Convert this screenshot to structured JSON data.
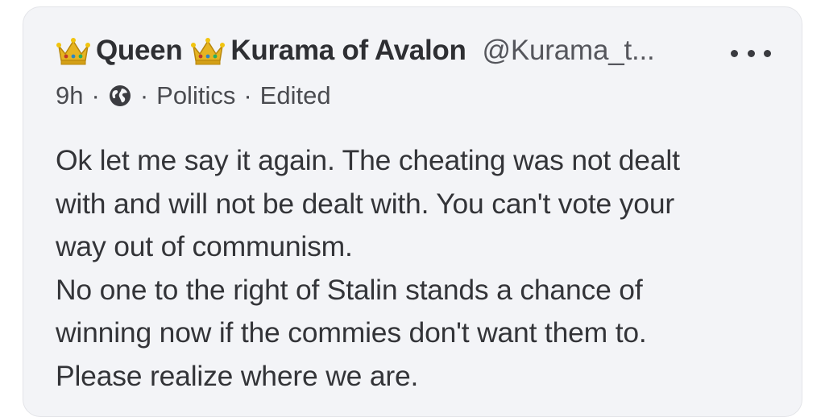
{
  "post": {
    "author": {
      "name_part1": "Queen",
      "name_part2": "Kurama of Avalon",
      "handle": "@Kurama_t..."
    },
    "meta": {
      "time": "9h",
      "separator": "·",
      "category": "Politics",
      "status": "Edited"
    },
    "lines": [
      "Ok let me say it again. The cheating was not dealt",
      "with and will not be dealt with. You can't vote your",
      "way out of communism.",
      "No one to the right of Stalin stands a chance of",
      "winning now if the commies don't want them to.",
      "Please realize where we are."
    ],
    "icons": {
      "crown": "crown-icon",
      "globe": "globe-icon",
      "more": "more-options-icon"
    }
  },
  "colors": {
    "card_background": "#f3f4f7",
    "text": "#333438",
    "crown_gold": "#e6b422",
    "crown_gem": "#c0392b"
  }
}
